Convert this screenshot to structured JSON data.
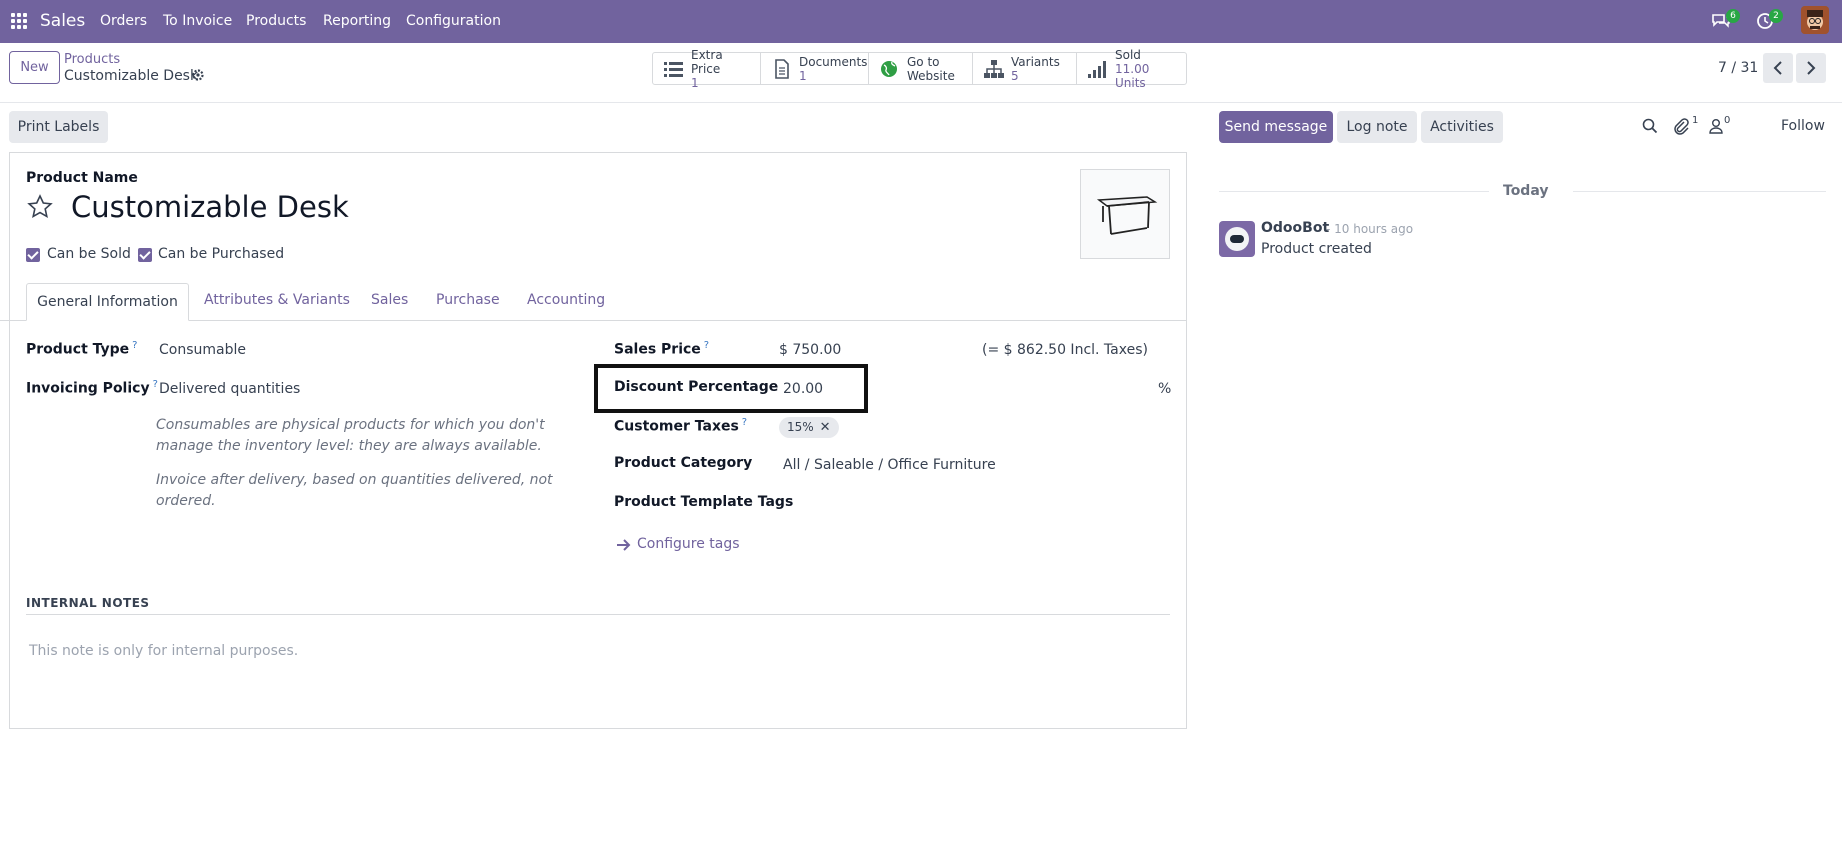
{
  "navbar": {
    "app": "Sales",
    "menu": [
      "Orders",
      "To Invoice",
      "Products",
      "Reporting",
      "Configuration"
    ],
    "messages_badge": "6",
    "activities_badge": "2"
  },
  "control": {
    "new_label": "New",
    "breadcrumb_parent": "Products",
    "breadcrumb_current": "Customizable Desk",
    "pager": "7 / 31",
    "smart_buttons": [
      {
        "icon": "list-icon",
        "line1": "Extra Price",
        "line2": "1"
      },
      {
        "icon": "document-icon",
        "line1": "Documents",
        "line2": "1"
      },
      {
        "icon": "globe-icon",
        "line1": "Go to",
        "line2": "Website"
      },
      {
        "icon": "sitemap-icon",
        "line1": "Variants",
        "line2": "5"
      },
      {
        "icon": "signal-icon",
        "line1": "Sold",
        "line2": "11.00 Units"
      }
    ]
  },
  "status": {
    "print_labels": "Print Labels"
  },
  "chatter_actions": {
    "send_message": "Send message",
    "log_note": "Log note",
    "activities": "Activities",
    "attachments_count": "1",
    "followers_count": "0",
    "follow": "Follow"
  },
  "form": {
    "product_name_label": "Product Name",
    "product_name": "Customizable Desk",
    "can_be_sold": "Can be Sold",
    "can_be_purchased": "Can be Purchased",
    "tabs": [
      "General Information",
      "Attributes & Variants",
      "Sales",
      "Purchase",
      "Accounting"
    ],
    "product_type_label": "Product Type",
    "product_type": "Consumable",
    "invoicing_policy_label": "Invoicing Policy",
    "invoicing_policy": "Delivered quantities",
    "consumable_help": "Consumables are physical products for which you don't manage the inventory level: they are always available.",
    "invoice_help": "Invoice after delivery, based on quantities delivered, not ordered.",
    "help_mark": "?",
    "sales_price_label": "Sales Price",
    "sales_price": "$ 750.00",
    "incl_taxes": "(= $ 862.50 Incl. Taxes)",
    "discount_label": "Discount Percentage",
    "discount_value": "20.00",
    "percent_sign": "%",
    "customer_taxes_label": "Customer Taxes",
    "customer_tax_tag": "15%",
    "product_category_label": "Product Category",
    "product_category": "All / Saleable / Office Furniture",
    "template_tags_label": "Product Template Tags",
    "configure_tags": "Configure tags",
    "internal_notes_title": "INTERNAL NOTES",
    "internal_notes_placeholder": "This note is only for internal purposes."
  },
  "chatter": {
    "date_separator": "Today",
    "author": "OdooBot",
    "time": "- 10 hours ago",
    "message": "Product created"
  },
  "colors": {
    "brand": "#71639e",
    "link": "#71639e",
    "badge": "#28a745"
  }
}
